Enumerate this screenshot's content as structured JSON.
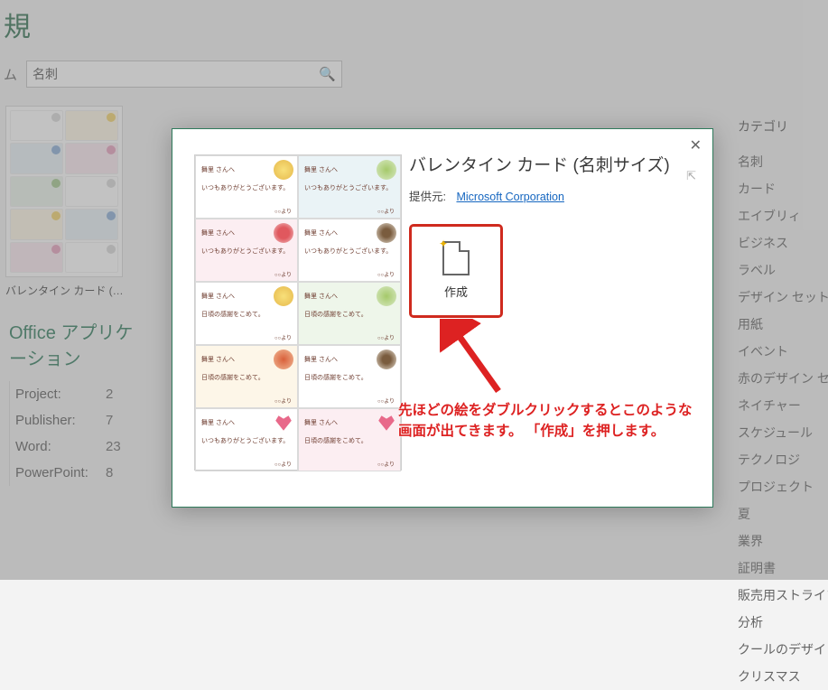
{
  "header": {
    "title_fragment": "規"
  },
  "toolbar": {
    "home_label": "ム"
  },
  "search": {
    "value": "名刺"
  },
  "thumbnail": {
    "caption": "バレンタイン カード (…"
  },
  "section": {
    "other_apps_title": "Office アプリケーション"
  },
  "apps": [
    {
      "name": "Project:",
      "count": "2"
    },
    {
      "name": "Publisher:",
      "count": "7"
    },
    {
      "name": "Word:",
      "count": "23"
    },
    {
      "name": "PowerPoint:",
      "count": "8"
    }
  ],
  "sidebar": {
    "title": "カテゴリ",
    "items": [
      "名刺",
      "カード",
      "エイブリィ",
      "ビジネス",
      "ラベル",
      "デザイン セット",
      "用紙",
      "イベント",
      "赤のデザイン セット",
      "ネイチャー",
      "スケジュール",
      "テクノロジ",
      "プロジェクト",
      "夏",
      "業界",
      "証明書",
      "販売用ストライプの",
      "分析",
      "クールのデザイン セ",
      "クリスマス"
    ]
  },
  "modal": {
    "title": "バレンタイン カード (名刺サイズ)",
    "provider_label": "提供元:",
    "provider_name": "Microsoft Corporation",
    "create_label": "作成",
    "annotation": "先ほどの絵をダブルクリックするとこのような画面が出てきます。\n「作成」を押します。",
    "card": {
      "to": "舞里 さんへ",
      "msg_thanks": "いつもありがとうございます。",
      "msg_grat": "日頃の感謝をこめて。",
      "from": "○○より"
    }
  }
}
